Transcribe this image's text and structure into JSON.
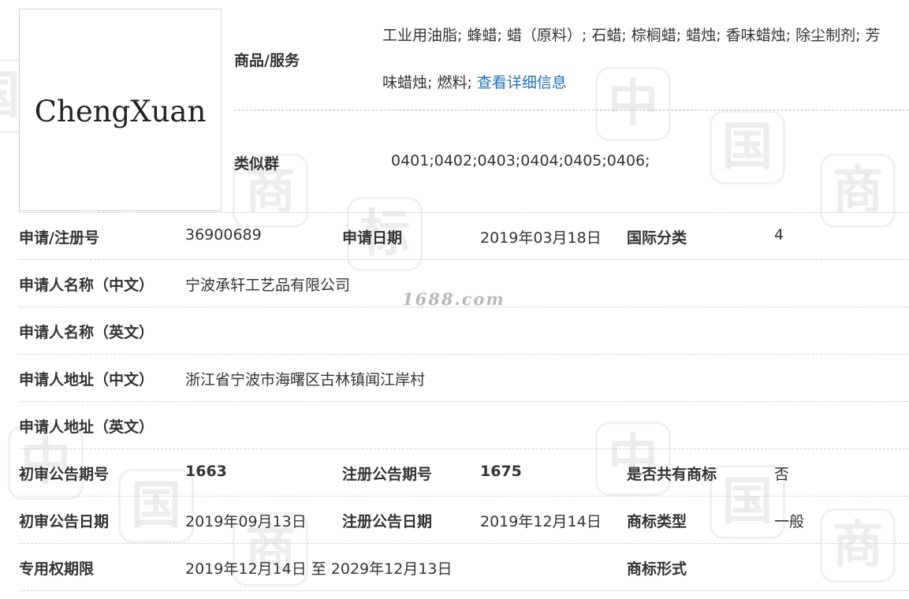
{
  "logo": {
    "text": "ChengXuan"
  },
  "watermark": {
    "site": "1688.com",
    "chars": [
      "中",
      "国",
      "商",
      "标"
    ]
  },
  "goods": {
    "label": "商品/服务",
    "line1": "工业用油脂; 蜂蜡; 蜡（原料）; 石蜡; 棕榈蜡; 蜡烛; 香味蜡烛; 除尘制剂; 芳",
    "line2": "味蜡烛; 燃料; ",
    "detail_link": "查看详细信息"
  },
  "similar_group": {
    "label": "类似群",
    "value": "0401;0402;0403;0404;0405;0406;"
  },
  "rows": {
    "reg_no": {
      "label": "申请/注册号",
      "value": "36900689"
    },
    "apply_date": {
      "label": "申请日期",
      "value": "2019年03月18日"
    },
    "intl_class": {
      "label": "国际分类",
      "value": "4"
    },
    "applicant_cn": {
      "label": "申请人名称（中文）",
      "value": "宁波承轩工艺品有限公司"
    },
    "applicant_en": {
      "label": "申请人名称（英文）",
      "value": ""
    },
    "address_cn": {
      "label": "申请人地址（中文）",
      "value": "浙江省宁波市海曙区古林镇闻江岸村"
    },
    "address_en": {
      "label": "申请人地址（英文）",
      "value": ""
    },
    "prelim_issue": {
      "label": "初审公告期号",
      "value": "1663"
    },
    "reg_issue": {
      "label": "注册公告期号",
      "value": "1675"
    },
    "shared": {
      "label": "是否共有商标",
      "value": "否"
    },
    "prelim_date": {
      "label": "初审公告日期",
      "value": "2019年09月13日"
    },
    "reg_date": {
      "label": "注册公告日期",
      "value": "2019年12月14日"
    },
    "tm_type": {
      "label": "商标类型",
      "value": "一般"
    },
    "valid_period": {
      "label": "专用权期限",
      "value": "2019年12月14日 至 2029年12月13日"
    },
    "tm_form": {
      "label": "商标形式",
      "value": ""
    }
  }
}
